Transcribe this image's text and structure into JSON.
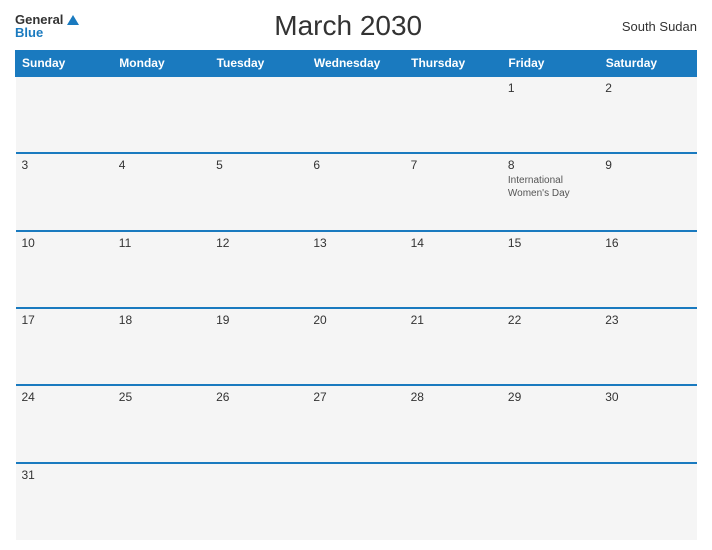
{
  "header": {
    "logo_general": "General",
    "logo_blue": "Blue",
    "title": "March 2030",
    "country": "South Sudan"
  },
  "days_of_week": [
    "Sunday",
    "Monday",
    "Tuesday",
    "Wednesday",
    "Thursday",
    "Friday",
    "Saturday"
  ],
  "weeks": [
    [
      {
        "day": "",
        "event": ""
      },
      {
        "day": "",
        "event": ""
      },
      {
        "day": "",
        "event": ""
      },
      {
        "day": "",
        "event": ""
      },
      {
        "day": "",
        "event": ""
      },
      {
        "day": "1",
        "event": ""
      },
      {
        "day": "2",
        "event": ""
      }
    ],
    [
      {
        "day": "3",
        "event": ""
      },
      {
        "day": "4",
        "event": ""
      },
      {
        "day": "5",
        "event": ""
      },
      {
        "day": "6",
        "event": ""
      },
      {
        "day": "7",
        "event": ""
      },
      {
        "day": "8",
        "event": "International Women's Day"
      },
      {
        "day": "9",
        "event": ""
      }
    ],
    [
      {
        "day": "10",
        "event": ""
      },
      {
        "day": "11",
        "event": ""
      },
      {
        "day": "12",
        "event": ""
      },
      {
        "day": "13",
        "event": ""
      },
      {
        "day": "14",
        "event": ""
      },
      {
        "day": "15",
        "event": ""
      },
      {
        "day": "16",
        "event": ""
      }
    ],
    [
      {
        "day": "17",
        "event": ""
      },
      {
        "day": "18",
        "event": ""
      },
      {
        "day": "19",
        "event": ""
      },
      {
        "day": "20",
        "event": ""
      },
      {
        "day": "21",
        "event": ""
      },
      {
        "day": "22",
        "event": ""
      },
      {
        "day": "23",
        "event": ""
      }
    ],
    [
      {
        "day": "24",
        "event": ""
      },
      {
        "day": "25",
        "event": ""
      },
      {
        "day": "26",
        "event": ""
      },
      {
        "day": "27",
        "event": ""
      },
      {
        "day": "28",
        "event": ""
      },
      {
        "day": "29",
        "event": ""
      },
      {
        "day": "30",
        "event": ""
      }
    ],
    [
      {
        "day": "31",
        "event": ""
      },
      {
        "day": "",
        "event": ""
      },
      {
        "day": "",
        "event": ""
      },
      {
        "day": "",
        "event": ""
      },
      {
        "day": "",
        "event": ""
      },
      {
        "day": "",
        "event": ""
      },
      {
        "day": "",
        "event": ""
      }
    ]
  ]
}
